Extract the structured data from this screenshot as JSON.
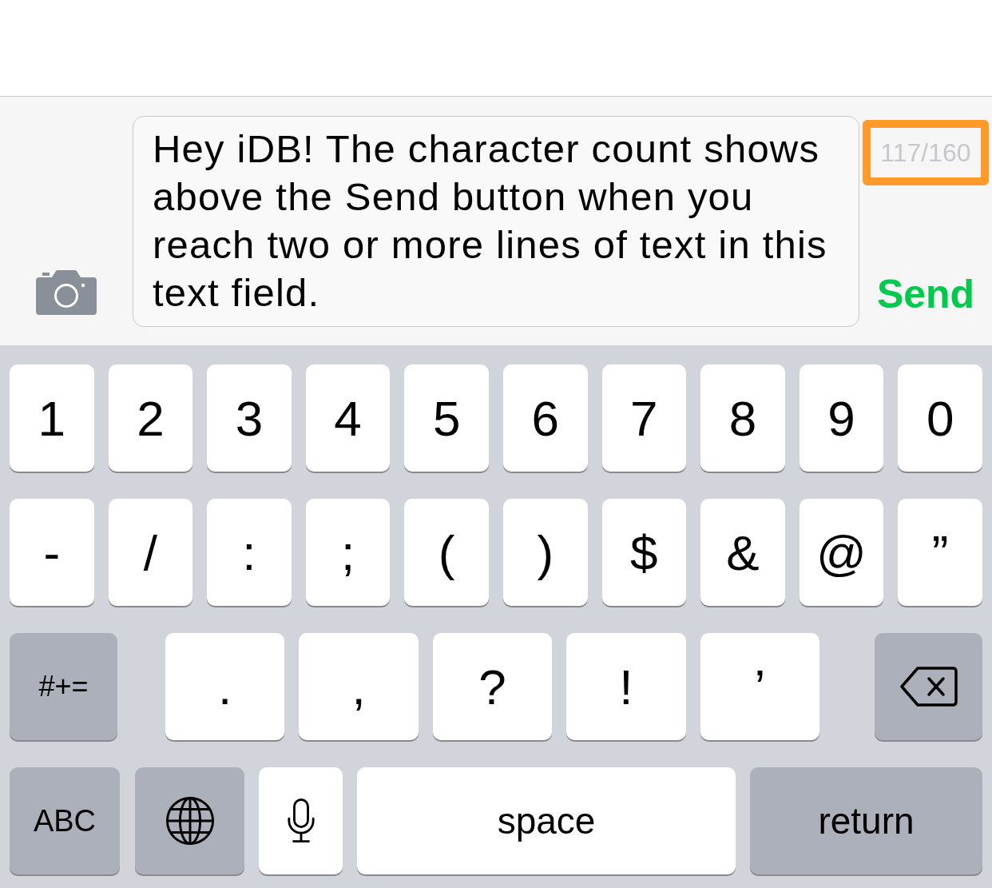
{
  "compose_bar": {
    "message_text": "Hey iDB! The character count shows above the Send button when you reach two or more lines of text in this text field.",
    "character_count": {
      "text": "117/160",
      "highlighted": true
    },
    "send_button": "Send"
  },
  "keyboard": {
    "rows": [
      {
        "keys": [
          {
            "kind": "char",
            "label": "1"
          },
          {
            "kind": "char",
            "label": "2"
          },
          {
            "kind": "char",
            "label": "3"
          },
          {
            "kind": "char",
            "label": "4"
          },
          {
            "kind": "char",
            "label": "5"
          },
          {
            "kind": "char",
            "label": "6"
          },
          {
            "kind": "char",
            "label": "7"
          },
          {
            "kind": "char",
            "label": "8"
          },
          {
            "kind": "char",
            "label": "9"
          },
          {
            "kind": "char",
            "label": "0"
          }
        ]
      },
      {
        "keys": [
          {
            "kind": "char",
            "label": "-"
          },
          {
            "kind": "char",
            "label": "/"
          },
          {
            "kind": "char",
            "label": ":"
          },
          {
            "kind": "char",
            "label": ";"
          },
          {
            "kind": "char",
            "label": "("
          },
          {
            "kind": "char",
            "label": ")"
          },
          {
            "kind": "char",
            "label": "$"
          },
          {
            "kind": "char",
            "label": "&"
          },
          {
            "kind": "char",
            "label": "@"
          },
          {
            "kind": "char",
            "label": "”"
          }
        ]
      },
      {
        "keys": [
          {
            "kind": "mode",
            "label": "#+="
          },
          {
            "kind": "char",
            "label": "."
          },
          {
            "kind": "char",
            "label": ","
          },
          {
            "kind": "char",
            "label": "?"
          },
          {
            "kind": "char",
            "label": "!"
          },
          {
            "kind": "char",
            "label": "’"
          },
          {
            "kind": "delete"
          }
        ]
      },
      {
        "keys": [
          {
            "kind": "mode",
            "label": "ABC"
          },
          {
            "kind": "globe"
          },
          {
            "kind": "dictation"
          },
          {
            "kind": "space",
            "label": "space"
          },
          {
            "kind": "return",
            "label": "return"
          }
        ]
      }
    ]
  }
}
